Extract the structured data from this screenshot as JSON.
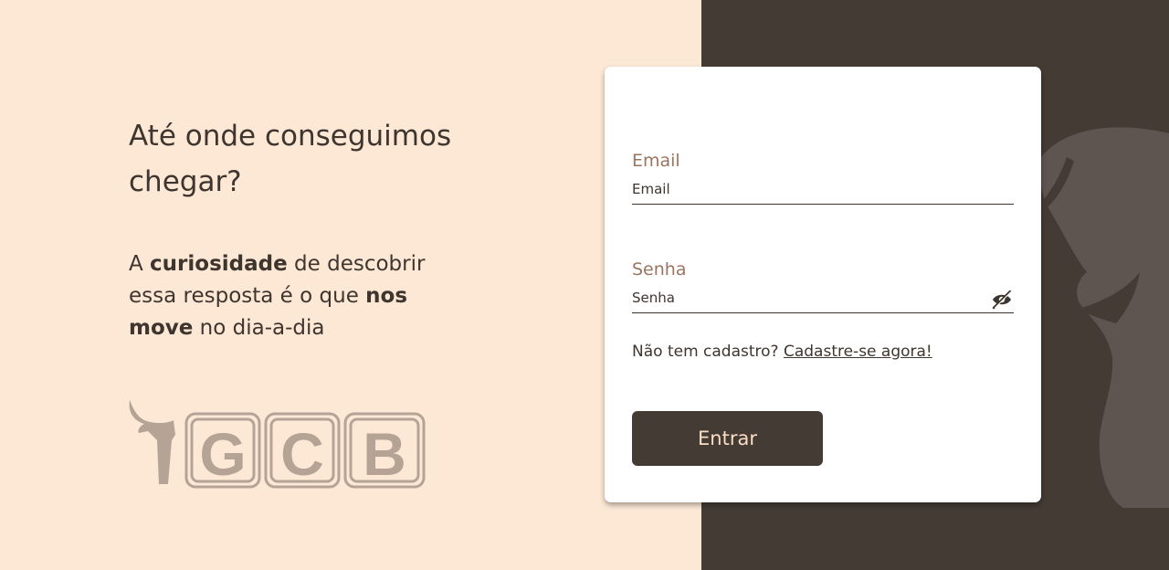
{
  "hero": {
    "headline": "Até onde conseguimos chegar?",
    "tagline": {
      "t1": "A ",
      "b1": "curiosidade",
      "t2": " de descobrir essa resposta é o que ",
      "b2": "nos move",
      "t3": " no dia-a-dia"
    },
    "logo_text": "GCB"
  },
  "login": {
    "email_label": "Email",
    "email_placeholder": "Email",
    "password_label": "Senha",
    "password_placeholder": "Senha",
    "signup_prompt": "Não tem cadastro?",
    "signup_link": "Cadastre-se agora!",
    "submit_label": "Entrar"
  },
  "icons": {
    "password_toggle": "eye-slash-icon",
    "logo": "bull-head-icon"
  },
  "colors": {
    "left_background": "#fde8d6",
    "right_background": "#443b35",
    "primary": "#443b35",
    "label": "#9b7560",
    "logo": "#b5a395"
  }
}
